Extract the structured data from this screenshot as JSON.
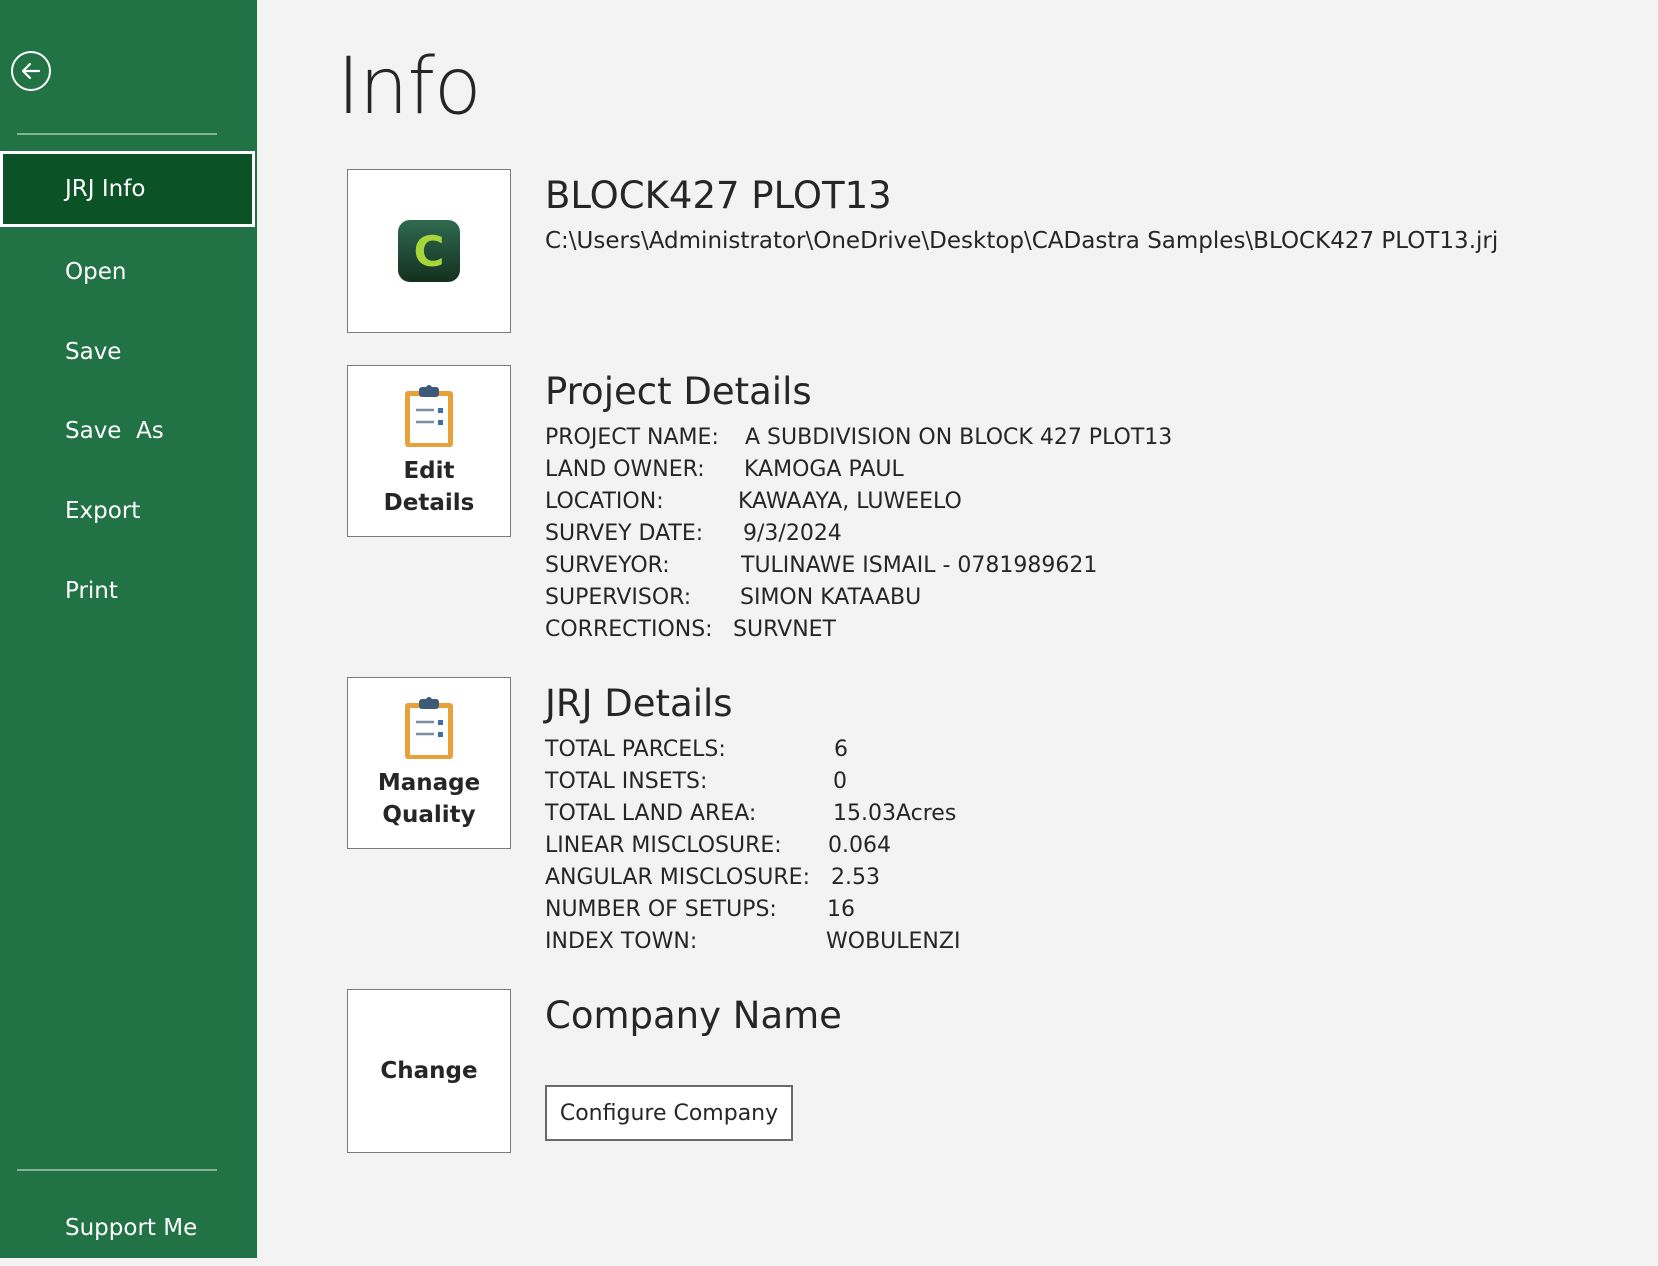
{
  "sidebar": {
    "items": [
      {
        "label": "JRJ Info",
        "active": true
      },
      {
        "label": "Open"
      },
      {
        "label": "Save"
      },
      {
        "label": "Save  As"
      },
      {
        "label": "Export"
      },
      {
        "label": "Print"
      }
    ],
    "support_label": "Support Me"
  },
  "page": {
    "title": "Info"
  },
  "file": {
    "name": "BLOCK427 PLOT13",
    "path": "C:\\Users\\Administrator\\OneDrive\\Desktop\\CADastra Samples\\BLOCK427 PLOT13.jrj",
    "icon": "cadastra-app-icon",
    "icon_letter": "C"
  },
  "project": {
    "title": "Project Details",
    "button_label": "Edit Details",
    "fields": [
      {
        "key": "PROJECT NAME:",
        "value": "A  SUBDIVISION ON BLOCK 427 PLOT13"
      },
      {
        "key": "LAND OWNER:",
        "value": "KAMOGA PAUL"
      },
      {
        "key": "LOCATION:",
        "value": "KAWAAYA, LUWEELO"
      },
      {
        "key": "SURVEY DATE:",
        "value": "9/3/2024"
      },
      {
        "key": "SURVEYOR:",
        "value": "TULINAWE ISMAIL - 0781989621"
      },
      {
        "key": "SUPERVISOR:",
        "value": "SIMON KATAABU"
      },
      {
        "key": "CORRECTIONS:",
        "value": "SURVNET"
      }
    ]
  },
  "jrj": {
    "title": "JRJ Details",
    "button_label": "Manage Quality",
    "fields": [
      {
        "key": "TOTAL PARCELS:",
        "value": "6"
      },
      {
        "key": "TOTAL INSETS:",
        "value": "0"
      },
      {
        "key": "TOTAL LAND AREA:",
        "value": "15.03Acres"
      },
      {
        "key": "LINEAR MISCLOSURE:",
        "value": "0.064"
      },
      {
        "key": "ANGULAR MISCLOSURE:",
        "value": "2.53"
      },
      {
        "key": "NUMBER OF SETUPS:",
        "value": "16"
      },
      {
        "key": "INDEX TOWN:",
        "value": "WOBULENZI"
      }
    ]
  },
  "company": {
    "title": "Company Name",
    "button_label": "Change",
    "configure_label": "Configure Company"
  },
  "colors": {
    "sidebar": "#217346",
    "sidebar_active": "#0b5327",
    "background": "#f3f3f3",
    "clipboard": "#e8a13a"
  }
}
